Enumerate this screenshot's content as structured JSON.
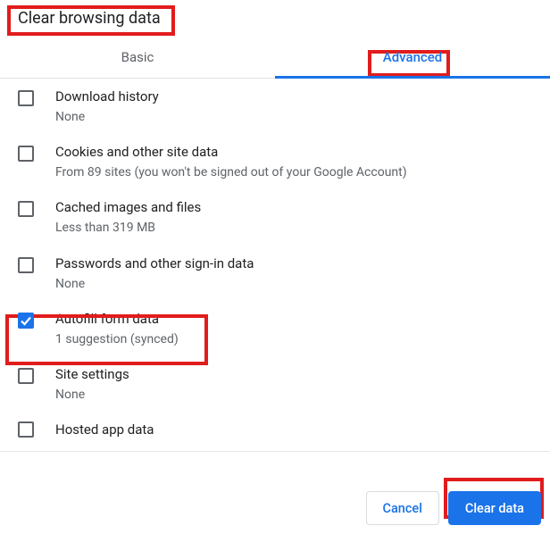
{
  "title": "Clear browsing data",
  "tabs": {
    "basic": "Basic",
    "advanced": "Advanced"
  },
  "items": [
    {
      "label": "Download history",
      "sub": "None",
      "checked": false
    },
    {
      "label": "Cookies and other site data",
      "sub": "From 89 sites (you won't be signed out of your Google Account)",
      "checked": false
    },
    {
      "label": "Cached images and files",
      "sub": "Less than 319 MB",
      "checked": false
    },
    {
      "label": "Passwords and other sign-in data",
      "sub": "None",
      "checked": false
    },
    {
      "label": "Autofill form data",
      "sub": "1 suggestion (synced)",
      "checked": true
    },
    {
      "label": "Site settings",
      "sub": "None",
      "checked": false
    },
    {
      "label": "Hosted app data",
      "sub": "",
      "checked": false
    }
  ],
  "buttons": {
    "cancel": "Cancel",
    "clear": "Clear data"
  }
}
